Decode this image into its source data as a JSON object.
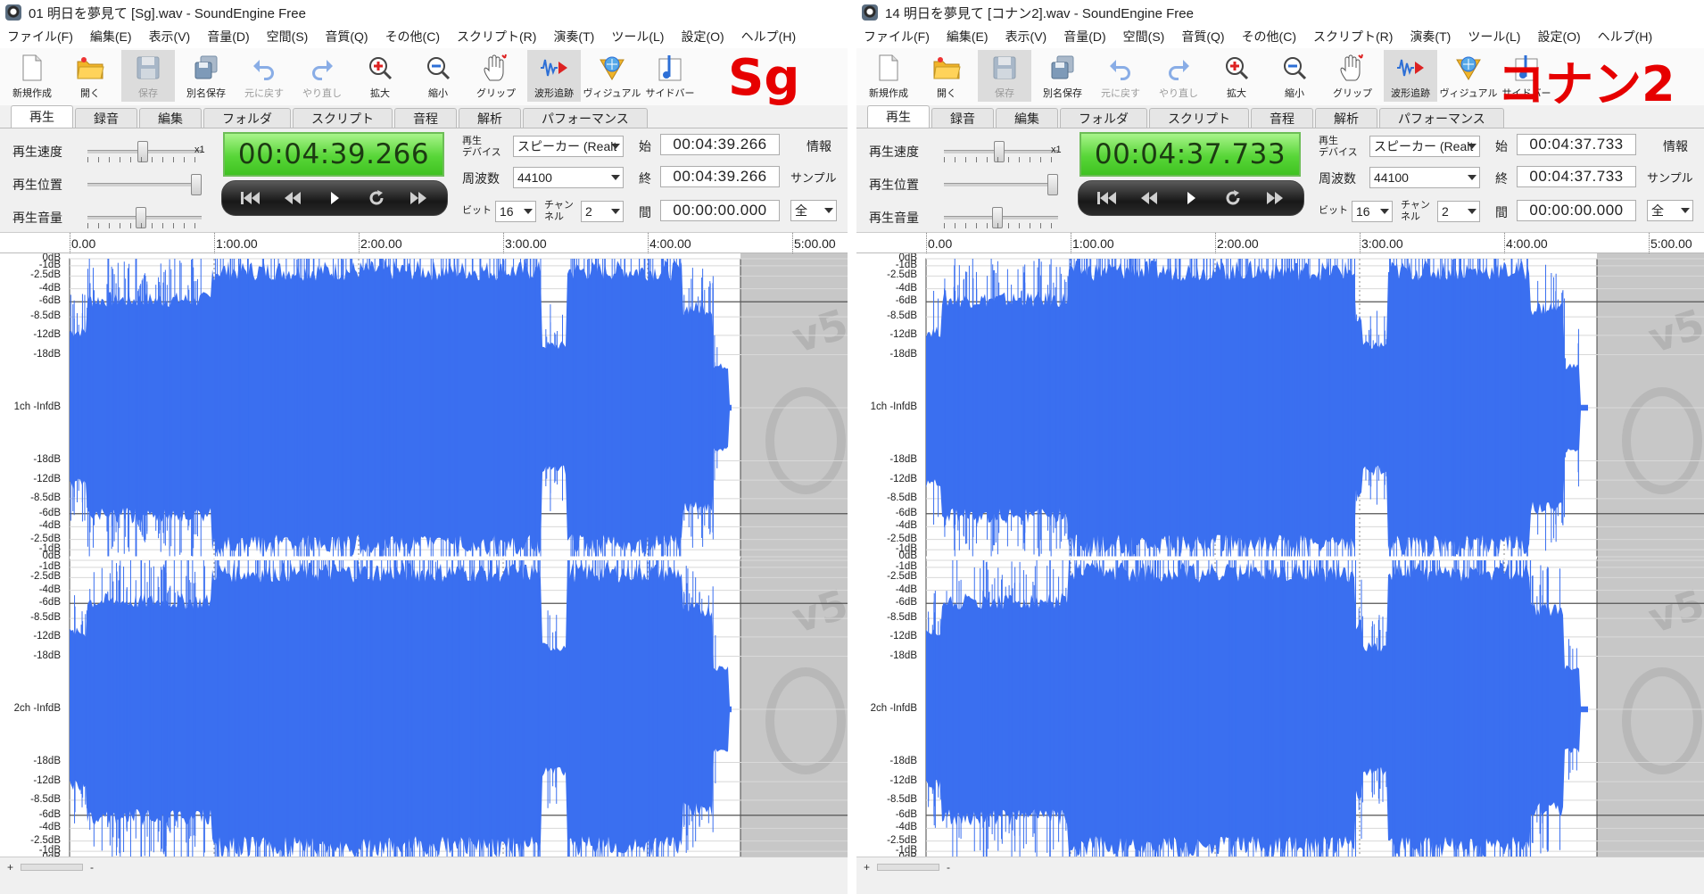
{
  "menus": [
    "ファイル(F)",
    "編集(E)",
    "表示(V)",
    "音量(D)",
    "空間(S)",
    "音質(Q)",
    "その他(C)",
    "スクリプト(R)",
    "演奏(T)",
    "ツール(L)",
    "設定(O)",
    "ヘルプ(H)"
  ],
  "toolbar": [
    {
      "label": "新規作成",
      "icon": "new-file-icon"
    },
    {
      "label": "開く",
      "icon": "open-folder-icon"
    },
    {
      "label": "保存",
      "icon": "save-icon"
    },
    {
      "label": "別名保存",
      "icon": "save-as-icon"
    },
    {
      "label": "元に戻す",
      "icon": "undo-icon"
    },
    {
      "label": "やり直し",
      "icon": "redo-icon"
    },
    {
      "label": "拡大",
      "icon": "zoom-in-icon"
    },
    {
      "label": "縮小",
      "icon": "zoom-out-icon"
    },
    {
      "label": "グリップ",
      "icon": "grip-hand-icon"
    },
    {
      "label": "波形追跡",
      "icon": "waveform-follow-icon"
    },
    {
      "label": "ヴィジュアル",
      "icon": "visual-icon"
    },
    {
      "label": "サイドバー",
      "icon": "sidebar-icon"
    }
  ],
  "tabs": [
    "再生",
    "録音",
    "編集",
    "フォルダ",
    "スクリプト",
    "音程",
    "解析",
    "パフォーマンス"
  ],
  "labels": {
    "speed": "再生速度",
    "position": "再生位置",
    "volume": "再生音量",
    "speed_mult": "x1",
    "device_top": "再生",
    "device_bottom": "デバイス",
    "freq": "周波数",
    "bit": "ビット",
    "channel_top": "チャン",
    "channel_bottom": "ネル",
    "start": "始",
    "end": "終",
    "span": "間",
    "info": "情報",
    "sample": "サンプル"
  },
  "ruler": [
    "0.00",
    "1:00.00",
    "2:00.00",
    "3:00.00",
    "4:00.00",
    "5:00.00"
  ],
  "db_labels": {
    "ch1": [
      "0dB",
      "-1dB",
      "-2.5dB",
      "-4dB",
      "-6dB",
      "-8.5dB",
      "-12dB",
      "-18dB",
      "1ch -InfdB",
      "-18dB",
      "-12dB",
      "-8.5dB",
      "-6dB",
      "-4dB",
      "-2.5dB",
      "-1dB",
      "0dB"
    ],
    "ch2": [
      "-1dB",
      "-2.5dB",
      "-4dB",
      "-6dB",
      "-8.5dB",
      "-12dB",
      "-18dB",
      "2ch -InfdB",
      "-18dB",
      "-12dB",
      "-8.5dB",
      "-6dB",
      "-4dB",
      "-2.5dB",
      "-1dB",
      "0dB"
    ]
  },
  "watermark": "v5",
  "status": {
    "plus": "+",
    "minus": "-"
  },
  "waveform_color": "#3a6ff0",
  "accent_red": "#e60000",
  "windows": [
    {
      "title": "01 明日を夢見て [Sg].wav - SoundEngine Free",
      "badge": "Sg",
      "time_display": "00:04:39.266",
      "device": "スピーカー (Realt",
      "frequency": "44100",
      "bit": "16",
      "channels": "2",
      "start": "00:04:39.266",
      "end": "00:04:39.266",
      "span": "00:00:00.000",
      "range": "全"
    },
    {
      "title": "14 明日を夢見て [コナン2].wav - SoundEngine Free",
      "badge": "コナン2",
      "time_display": "00:04:37.733",
      "device": "スピーカー (Realt",
      "frequency": "44100",
      "bit": "16",
      "channels": "2",
      "start": "00:04:37.733",
      "end": "00:04:37.733",
      "span": "00:00:00.000",
      "range": "全"
    }
  ]
}
